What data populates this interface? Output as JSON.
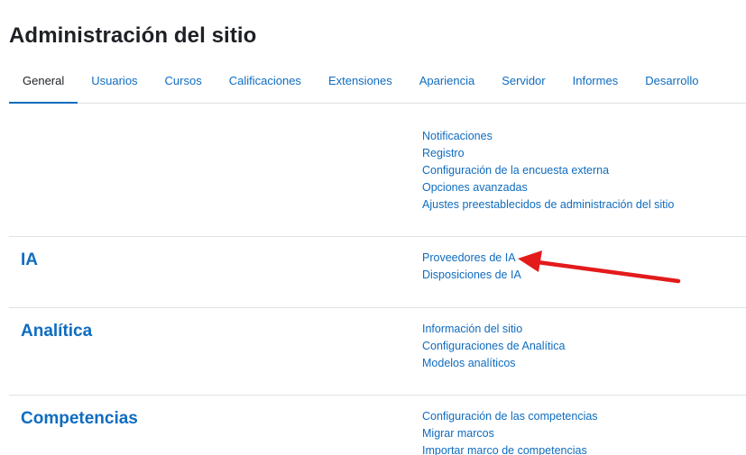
{
  "page": {
    "title": "Administración del sitio"
  },
  "tabs": [
    {
      "label": "General",
      "active": true
    },
    {
      "label": "Usuarios"
    },
    {
      "label": "Cursos"
    },
    {
      "label": "Calificaciones"
    },
    {
      "label": "Extensiones"
    },
    {
      "label": "Apariencia"
    },
    {
      "label": "Servidor"
    },
    {
      "label": "Informes"
    },
    {
      "label": "Desarrollo"
    }
  ],
  "sections": {
    "general": {
      "links": [
        "Notificaciones",
        "Registro",
        "Configuración de la encuesta externa",
        "Opciones avanzadas",
        "Ajustes preestablecidos de administración del sitio"
      ]
    },
    "ia": {
      "title": "IA",
      "links": [
        "Proveedores de IA",
        "Disposiciones de IA"
      ]
    },
    "analitica": {
      "title": "Analítica",
      "links": [
        "Información del sitio",
        "Configuraciones de Analítica",
        "Modelos analíticos"
      ]
    },
    "competencias": {
      "title": "Competencias",
      "links": [
        "Configuración de las competencias",
        "Migrar marcos",
        "Importar marco de competencias"
      ]
    }
  },
  "annotation": {
    "arrow_color": "#e31b1b",
    "arrow_icon": "red-pointer-arrow"
  },
  "colors": {
    "link": "#0f6cbf",
    "text": "#1d2125",
    "divider": "#dee2e6"
  }
}
